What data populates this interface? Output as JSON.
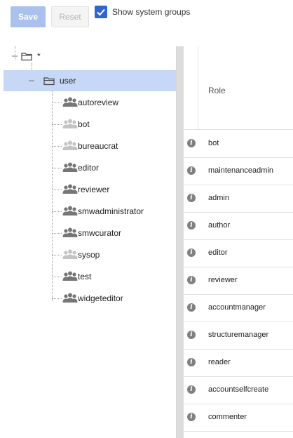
{
  "toolbar": {
    "save_label": "Save",
    "reset_label": "Reset",
    "show_system_groups_label": "Show system groups",
    "show_system_groups_checked": true
  },
  "tree": {
    "root": {
      "label": "*"
    },
    "user": {
      "label": "user"
    },
    "groups": [
      {
        "label": "autoreview",
        "faded": false
      },
      {
        "label": "bot",
        "faded": true
      },
      {
        "label": "bureaucrat",
        "faded": true
      },
      {
        "label": "editor",
        "faded": false
      },
      {
        "label": "reviewer",
        "faded": false
      },
      {
        "label": "smwadministrator",
        "faded": false
      },
      {
        "label": "smwcurator",
        "faded": false
      },
      {
        "label": "sysop",
        "faded": true
      },
      {
        "label": "test",
        "faded": false
      },
      {
        "label": "widgeteditor",
        "faded": false
      }
    ]
  },
  "grid": {
    "header": "Role",
    "rows": [
      "bot",
      "maintenanceadmin",
      "admin",
      "author",
      "editor",
      "reviewer",
      "accountmanager",
      "structuremanager",
      "reader",
      "accountselfcreate",
      "commenter"
    ]
  },
  "colors": {
    "accent": "#3366cc",
    "selected_row": "#c6d8f5",
    "icon_gray": "#808080"
  }
}
